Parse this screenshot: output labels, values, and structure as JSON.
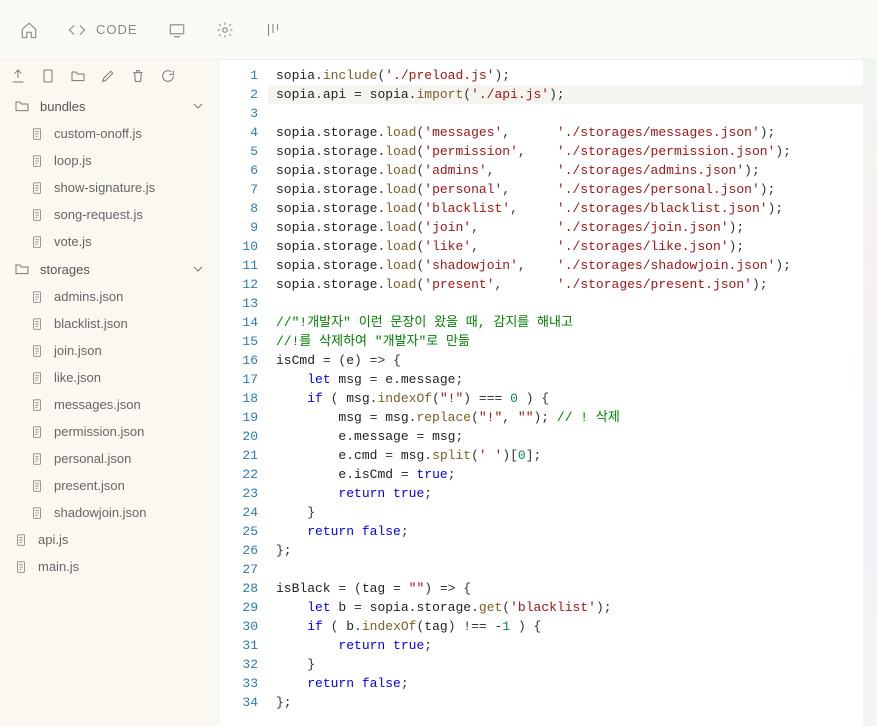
{
  "topbar": {
    "code_label": "CODE"
  },
  "sidebar": {
    "folders": [
      {
        "name": "bundles",
        "files": [
          "custom-onoff.js",
          "loop.js",
          "show-signature.js",
          "song-request.js",
          "vote.js"
        ]
      },
      {
        "name": "storages",
        "files": [
          "admins.json",
          "blacklist.json",
          "join.json",
          "like.json",
          "messages.json",
          "permission.json",
          "personal.json",
          "present.json",
          "shadowjoin.json"
        ]
      }
    ],
    "root_files": [
      "api.js",
      "main.js"
    ]
  },
  "code": {
    "lines": [
      {
        "n": 1,
        "t": [
          [
            "obj",
            "sopia"
          ],
          [
            "punc",
            "."
          ],
          [
            "fn",
            "include"
          ],
          [
            "punc",
            "("
          ],
          [
            "str",
            "'./preload.js'"
          ],
          [
            "punc",
            ");"
          ]
        ]
      },
      {
        "n": 2,
        "hl": true,
        "t": [
          [
            "obj",
            "sopia"
          ],
          [
            "punc",
            "."
          ],
          [
            "prop",
            "api"
          ],
          [
            "op",
            " = "
          ],
          [
            "obj",
            "sopia"
          ],
          [
            "punc",
            "."
          ],
          [
            "fn",
            "import"
          ],
          [
            "punc",
            "("
          ],
          [
            "str",
            "'./api.js'"
          ],
          [
            "punc",
            ");"
          ]
        ]
      },
      {
        "n": 3,
        "t": []
      },
      {
        "n": 4,
        "t": [
          [
            "obj",
            "sopia"
          ],
          [
            "punc",
            "."
          ],
          [
            "prop",
            "storage"
          ],
          [
            "punc",
            "."
          ],
          [
            "fn",
            "load"
          ],
          [
            "punc",
            "("
          ],
          [
            "str",
            "'messages'"
          ],
          [
            "punc",
            ",      "
          ],
          [
            "str",
            "'./storages/messages.json'"
          ],
          [
            "punc",
            ");"
          ]
        ]
      },
      {
        "n": 5,
        "t": [
          [
            "obj",
            "sopia"
          ],
          [
            "punc",
            "."
          ],
          [
            "prop",
            "storage"
          ],
          [
            "punc",
            "."
          ],
          [
            "fn",
            "load"
          ],
          [
            "punc",
            "("
          ],
          [
            "str",
            "'permission'"
          ],
          [
            "punc",
            ",    "
          ],
          [
            "str",
            "'./storages/permission.json'"
          ],
          [
            "punc",
            ");"
          ]
        ]
      },
      {
        "n": 6,
        "t": [
          [
            "obj",
            "sopia"
          ],
          [
            "punc",
            "."
          ],
          [
            "prop",
            "storage"
          ],
          [
            "punc",
            "."
          ],
          [
            "fn",
            "load"
          ],
          [
            "punc",
            "("
          ],
          [
            "str",
            "'admins'"
          ],
          [
            "punc",
            ",        "
          ],
          [
            "str",
            "'./storages/admins.json'"
          ],
          [
            "punc",
            ");"
          ]
        ]
      },
      {
        "n": 7,
        "t": [
          [
            "obj",
            "sopia"
          ],
          [
            "punc",
            "."
          ],
          [
            "prop",
            "storage"
          ],
          [
            "punc",
            "."
          ],
          [
            "fn",
            "load"
          ],
          [
            "punc",
            "("
          ],
          [
            "str",
            "'personal'"
          ],
          [
            "punc",
            ",      "
          ],
          [
            "str",
            "'./storages/personal.json'"
          ],
          [
            "punc",
            ");"
          ]
        ]
      },
      {
        "n": 8,
        "t": [
          [
            "obj",
            "sopia"
          ],
          [
            "punc",
            "."
          ],
          [
            "prop",
            "storage"
          ],
          [
            "punc",
            "."
          ],
          [
            "fn",
            "load"
          ],
          [
            "punc",
            "("
          ],
          [
            "str",
            "'blacklist'"
          ],
          [
            "punc",
            ",     "
          ],
          [
            "str",
            "'./storages/blacklist.json'"
          ],
          [
            "punc",
            ");"
          ]
        ]
      },
      {
        "n": 9,
        "t": [
          [
            "obj",
            "sopia"
          ],
          [
            "punc",
            "."
          ],
          [
            "prop",
            "storage"
          ],
          [
            "punc",
            "."
          ],
          [
            "fn",
            "load"
          ],
          [
            "punc",
            "("
          ],
          [
            "str",
            "'join'"
          ],
          [
            "punc",
            ",          "
          ],
          [
            "str",
            "'./storages/join.json'"
          ],
          [
            "punc",
            ");"
          ]
        ]
      },
      {
        "n": 10,
        "t": [
          [
            "obj",
            "sopia"
          ],
          [
            "punc",
            "."
          ],
          [
            "prop",
            "storage"
          ],
          [
            "punc",
            "."
          ],
          [
            "fn",
            "load"
          ],
          [
            "punc",
            "("
          ],
          [
            "str",
            "'like'"
          ],
          [
            "punc",
            ",          "
          ],
          [
            "str",
            "'./storages/like.json'"
          ],
          [
            "punc",
            ");"
          ]
        ]
      },
      {
        "n": 11,
        "t": [
          [
            "obj",
            "sopia"
          ],
          [
            "punc",
            "."
          ],
          [
            "prop",
            "storage"
          ],
          [
            "punc",
            "."
          ],
          [
            "fn",
            "load"
          ],
          [
            "punc",
            "("
          ],
          [
            "str",
            "'shadowjoin'"
          ],
          [
            "punc",
            ",    "
          ],
          [
            "str",
            "'./storages/shadowjoin.json'"
          ],
          [
            "punc",
            ");"
          ]
        ]
      },
      {
        "n": 12,
        "t": [
          [
            "obj",
            "sopia"
          ],
          [
            "punc",
            "."
          ],
          [
            "prop",
            "storage"
          ],
          [
            "punc",
            "."
          ],
          [
            "fn",
            "load"
          ],
          [
            "punc",
            "("
          ],
          [
            "str",
            "'present'"
          ],
          [
            "punc",
            ",       "
          ],
          [
            "str",
            "'./storages/present.json'"
          ],
          [
            "punc",
            ");"
          ]
        ]
      },
      {
        "n": 13,
        "t": []
      },
      {
        "n": 14,
        "t": [
          [
            "comment",
            "//\"!개발자\" 이런 문장이 왔을 때, 감지를 해내고"
          ]
        ]
      },
      {
        "n": 15,
        "t": [
          [
            "comment",
            "//!를 삭제하여 \"개발자\"로 만듦"
          ]
        ]
      },
      {
        "n": 16,
        "t": [
          [
            "obj",
            "isCmd"
          ],
          [
            "op",
            " = "
          ],
          [
            "punc",
            "("
          ],
          [
            "obj",
            "e"
          ],
          [
            "punc",
            ") "
          ],
          [
            "op",
            "=>"
          ],
          [
            "punc",
            " {"
          ]
        ]
      },
      {
        "n": 17,
        "t": [
          [
            "punc",
            "    "
          ],
          [
            "kw",
            "let"
          ],
          [
            "obj",
            " msg "
          ],
          [
            "op",
            "="
          ],
          [
            "obj",
            " e"
          ],
          [
            "punc",
            "."
          ],
          [
            "prop",
            "message"
          ],
          [
            "punc",
            ";"
          ]
        ]
      },
      {
        "n": 18,
        "t": [
          [
            "punc",
            "    "
          ],
          [
            "kw",
            "if"
          ],
          [
            "punc",
            " ( "
          ],
          [
            "obj",
            "msg"
          ],
          [
            "punc",
            "."
          ],
          [
            "fn",
            "indexOf"
          ],
          [
            "punc",
            "("
          ],
          [
            "str",
            "\"!\""
          ],
          [
            "punc",
            ") "
          ],
          [
            "op",
            "==="
          ],
          [
            "punc",
            " "
          ],
          [
            "num",
            "0"
          ],
          [
            "punc",
            " ) {"
          ]
        ]
      },
      {
        "n": 19,
        "t": [
          [
            "punc",
            "        "
          ],
          [
            "obj",
            "msg"
          ],
          [
            "op",
            " = "
          ],
          [
            "obj",
            "msg"
          ],
          [
            "punc",
            "."
          ],
          [
            "fn",
            "replace"
          ],
          [
            "punc",
            "("
          ],
          [
            "str",
            "\"!\""
          ],
          [
            "punc",
            ", "
          ],
          [
            "str",
            "\"\""
          ],
          [
            "punc",
            "); "
          ],
          [
            "comment",
            "// ! 삭제"
          ]
        ]
      },
      {
        "n": 20,
        "t": [
          [
            "punc",
            "        "
          ],
          [
            "obj",
            "e"
          ],
          [
            "punc",
            "."
          ],
          [
            "prop",
            "message"
          ],
          [
            "op",
            " = "
          ],
          [
            "obj",
            "msg"
          ],
          [
            "punc",
            ";"
          ]
        ]
      },
      {
        "n": 21,
        "t": [
          [
            "punc",
            "        "
          ],
          [
            "obj",
            "e"
          ],
          [
            "punc",
            "."
          ],
          [
            "prop",
            "cmd"
          ],
          [
            "op",
            " = "
          ],
          [
            "obj",
            "msg"
          ],
          [
            "punc",
            "."
          ],
          [
            "fn",
            "split"
          ],
          [
            "punc",
            "("
          ],
          [
            "str",
            "' '"
          ],
          [
            "punc",
            ")["
          ],
          [
            "num",
            "0"
          ],
          [
            "punc",
            "];"
          ]
        ]
      },
      {
        "n": 22,
        "t": [
          [
            "punc",
            "        "
          ],
          [
            "obj",
            "e"
          ],
          [
            "punc",
            "."
          ],
          [
            "prop",
            "isCmd"
          ],
          [
            "op",
            " = "
          ],
          [
            "const",
            "true"
          ],
          [
            "punc",
            ";"
          ]
        ]
      },
      {
        "n": 23,
        "t": [
          [
            "punc",
            "        "
          ],
          [
            "kw",
            "return"
          ],
          [
            "punc",
            " "
          ],
          [
            "const",
            "true"
          ],
          [
            "punc",
            ";"
          ]
        ]
      },
      {
        "n": 24,
        "t": [
          [
            "punc",
            "    }"
          ]
        ]
      },
      {
        "n": 25,
        "t": [
          [
            "punc",
            "    "
          ],
          [
            "kw",
            "return"
          ],
          [
            "punc",
            " "
          ],
          [
            "const",
            "false"
          ],
          [
            "punc",
            ";"
          ]
        ]
      },
      {
        "n": 26,
        "t": [
          [
            "punc",
            "};"
          ]
        ]
      },
      {
        "n": 27,
        "t": []
      },
      {
        "n": 28,
        "t": [
          [
            "obj",
            "isBlack"
          ],
          [
            "op",
            " = "
          ],
          [
            "punc",
            "("
          ],
          [
            "obj",
            "tag"
          ],
          [
            "op",
            " = "
          ],
          [
            "str",
            "\"\""
          ],
          [
            "punc",
            ") "
          ],
          [
            "op",
            "=>"
          ],
          [
            "punc",
            " {"
          ]
        ]
      },
      {
        "n": 29,
        "t": [
          [
            "punc",
            "    "
          ],
          [
            "kw",
            "let"
          ],
          [
            "obj",
            " b "
          ],
          [
            "op",
            "="
          ],
          [
            "obj",
            " sopia"
          ],
          [
            "punc",
            "."
          ],
          [
            "prop",
            "storage"
          ],
          [
            "punc",
            "."
          ],
          [
            "fn",
            "get"
          ],
          [
            "punc",
            "("
          ],
          [
            "str",
            "'blacklist'"
          ],
          [
            "punc",
            ");"
          ]
        ]
      },
      {
        "n": 30,
        "t": [
          [
            "punc",
            "    "
          ],
          [
            "kw",
            "if"
          ],
          [
            "punc",
            " ( "
          ],
          [
            "obj",
            "b"
          ],
          [
            "punc",
            "."
          ],
          [
            "fn",
            "indexOf"
          ],
          [
            "punc",
            "("
          ],
          [
            "obj",
            "tag"
          ],
          [
            "punc",
            ") "
          ],
          [
            "op",
            "!=="
          ],
          [
            "punc",
            " "
          ],
          [
            "op",
            "-"
          ],
          [
            "num",
            "1"
          ],
          [
            "punc",
            " ) {"
          ]
        ]
      },
      {
        "n": 31,
        "t": [
          [
            "punc",
            "        "
          ],
          [
            "kw",
            "return"
          ],
          [
            "punc",
            " "
          ],
          [
            "const",
            "true"
          ],
          [
            "punc",
            ";"
          ]
        ]
      },
      {
        "n": 32,
        "t": [
          [
            "punc",
            "    }"
          ]
        ]
      },
      {
        "n": 33,
        "t": [
          [
            "punc",
            "    "
          ],
          [
            "kw",
            "return"
          ],
          [
            "punc",
            " "
          ],
          [
            "const",
            "false"
          ],
          [
            "punc",
            ";"
          ]
        ]
      },
      {
        "n": 34,
        "t": [
          [
            "punc",
            "};"
          ]
        ]
      }
    ]
  }
}
